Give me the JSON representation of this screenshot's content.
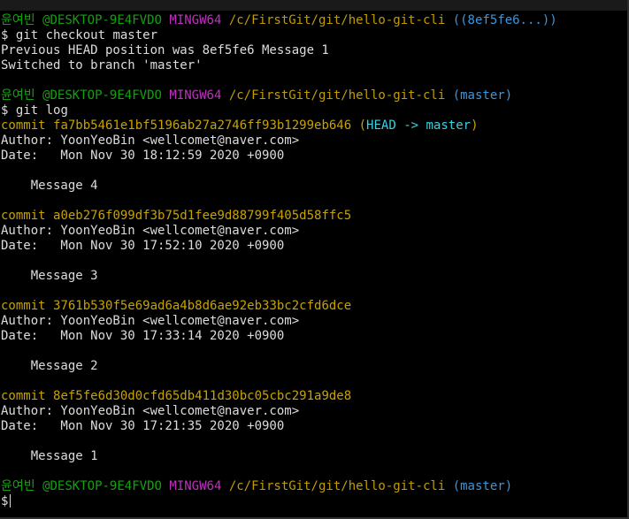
{
  "prompt": {
    "user": "윤여빈",
    "host": "@DESKTOP-9E4FVDO",
    "shell": "MINGW64",
    "path": "/c/FirstGit/git/hello-git-cli",
    "branch_detached": "((8ef5fe6...))",
    "branch_master": "(master)",
    "symbol": "$"
  },
  "commands": {
    "checkout": "git checkout master",
    "log": "git log"
  },
  "checkout_output": {
    "line1": "Previous HEAD position was 8ef5fe6 Message 1",
    "line2": "Switched to branch 'master'"
  },
  "log": {
    "commit_prefix": "commit",
    "head_ref": "(HEAD -> master)",
    "head_open": "(",
    "head_label": "HEAD -> master",
    "head_close": ")",
    "commits": [
      {
        "hash": "fa7bb5461e1bf5196ab27a2746ff93b1299eb646",
        "author": "Author: YoonYeoBin <wellcomet@naver.com>",
        "date": "Date:   Mon Nov 30 18:12:59 2020 +0900",
        "message": "Message 4"
      },
      {
        "hash": "a0eb276f099df3b75d1fee9d88799f405d58ffc5",
        "author": "Author: YoonYeoBin <wellcomet@naver.com>",
        "date": "Date:   Mon Nov 30 17:52:10 2020 +0900",
        "message": "Message 3"
      },
      {
        "hash": "3761b530f5e69ad6a4b8d6ae92eb33bc2cfd6dce",
        "author": "Author: YoonYeoBin <wellcomet@naver.com>",
        "date": "Date:   Mon Nov 30 17:33:14 2020 +0900",
        "message": "Message 2"
      },
      {
        "hash": "8ef5fe6d30d0cfd65db411d30bc05cbc291a9de8",
        "author": "Author: YoonYeoBin <wellcomet@naver.com>",
        "date": "Date:   Mon Nov 30 17:21:35 2020 +0900",
        "message": "Message 1"
      }
    ]
  },
  "colors": {
    "background": "#000000",
    "text": "#dcdcdc",
    "user_host": "#13a10e",
    "shell": "#c030c0",
    "path": "#c19c00",
    "branch": "#3a96dd",
    "commit": "#c7a200",
    "head": "#3ad0dd",
    "head_branch": "#16c60c"
  }
}
